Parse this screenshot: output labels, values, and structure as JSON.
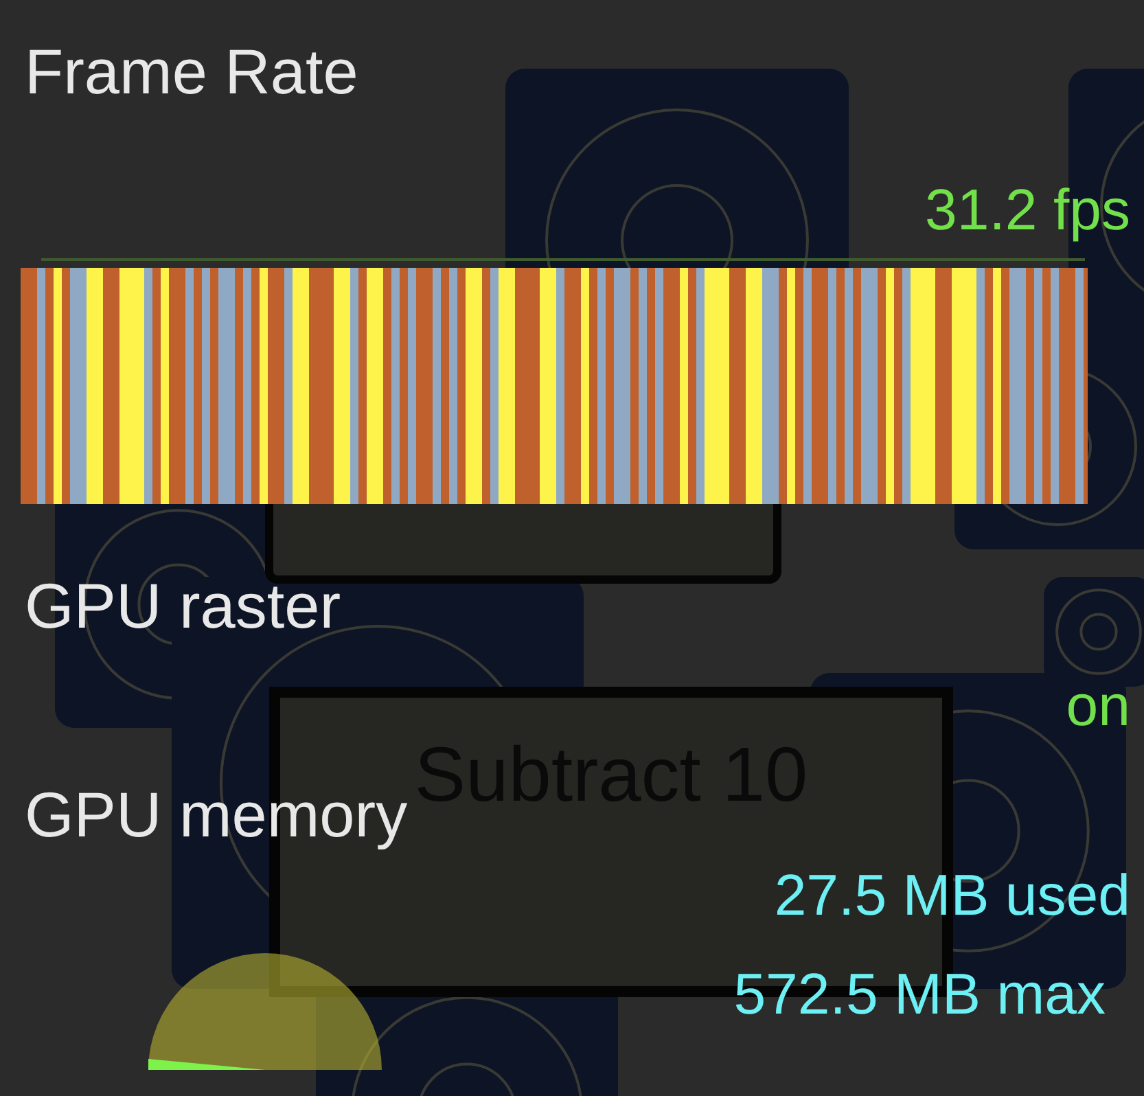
{
  "background": {
    "box_text": "Subtract 10"
  },
  "frame_rate": {
    "title": "Frame Rate",
    "reading": "31.2 fps"
  },
  "gpu_raster": {
    "title": "GPU raster",
    "status": "on"
  },
  "gpu_memory": {
    "title": "GPU memory",
    "used": "27.5 MB used",
    "max": "572.5 MB max"
  }
}
